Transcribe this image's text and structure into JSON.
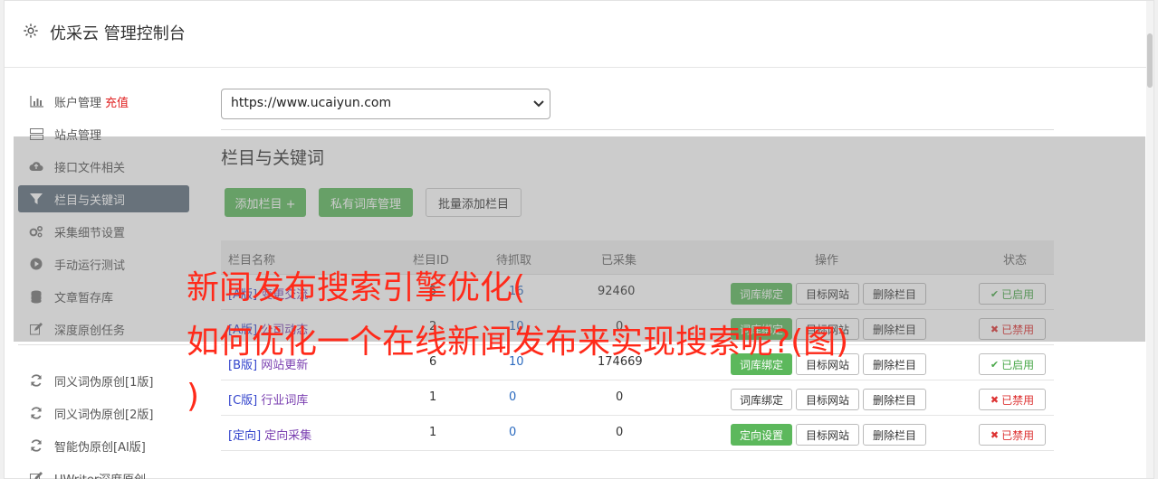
{
  "header": {
    "title": "优采云 管理控制台"
  },
  "sidebar": {
    "items": [
      {
        "label": "账户管理",
        "extra": "充值",
        "icon": "bar-chart-icon"
      },
      {
        "label": "站点管理",
        "icon": "server-icon"
      },
      {
        "label": "接口文件相关",
        "icon": "cloud-upload-icon"
      },
      {
        "label": "栏目与关键词",
        "icon": "filter-icon",
        "active": true
      },
      {
        "label": "采集细节设置",
        "icon": "cogs-icon"
      },
      {
        "label": "手动运行测试",
        "icon": "play-circle-icon"
      },
      {
        "label": "文章暂存库",
        "icon": "database-icon"
      },
      {
        "label": "深度原创任务",
        "icon": "edit-icon"
      },
      {
        "label": "同义词伪原创[1版]",
        "icon": "refresh-icon"
      },
      {
        "label": "同义词伪原创[2版]",
        "icon": "refresh-icon"
      },
      {
        "label": "智能伪原创[AI版]",
        "icon": "refresh-icon"
      },
      {
        "label": "UWriter深度原创",
        "icon": "edit-icon"
      }
    ]
  },
  "main": {
    "site_select": "https://www.ucaiyun.com",
    "section_title": "栏目与关键词",
    "buttons": {
      "add_column": "添加栏目 +",
      "private_lexicon": "私有词库管理",
      "batch_add": "批量添加栏目"
    },
    "table": {
      "headers": [
        "栏目名称",
        "栏目ID",
        "待抓取",
        "已采集",
        "操作",
        "状态"
      ],
      "rows": [
        {
          "tag": "[A版]",
          "name": "变更交流",
          "id": "5",
          "pending": "16",
          "collected": "92460",
          "op1": "词库绑定",
          "op1_green": true,
          "op2": "目标网站",
          "op3": "删除栏目",
          "status": "已启用",
          "on": true
        },
        {
          "tag": "[A版]",
          "name": "公司动态",
          "id": "2",
          "pending": "10",
          "collected": "0",
          "op1": "词库绑定",
          "op1_green": true,
          "op2": "目标网站",
          "op3": "删除栏目",
          "status": "已禁用",
          "on": false
        },
        {
          "tag": "[B版]",
          "name": "网站更新",
          "id": "6",
          "pending": "10",
          "collected": "174669",
          "op1": "词库绑定",
          "op1_green": true,
          "op2": "目标网站",
          "op3": "删除栏目",
          "status": "已启用",
          "on": true
        },
        {
          "tag": "[C版]",
          "name": "行业词库",
          "id": "1",
          "pending": "0",
          "collected": "0",
          "op1": "词库绑定",
          "op1_green": false,
          "op2": "目标网站",
          "op3": "删除栏目",
          "status": "已禁用",
          "on": false
        },
        {
          "tag": "[定向]",
          "name": "定向采集",
          "id": "1",
          "pending": "0",
          "collected": "0",
          "op1": "定向设置",
          "op1_green": true,
          "op2": "目标网站",
          "op3": "删除栏目",
          "status": "已禁用",
          "on": false
        }
      ]
    }
  },
  "watermark": {
    "line1": "新闻发布搜索引擎优化(",
    "line2": "如何优化一个在线新闻发布来实现搜索呢?(图)",
    "line3": ")"
  }
}
